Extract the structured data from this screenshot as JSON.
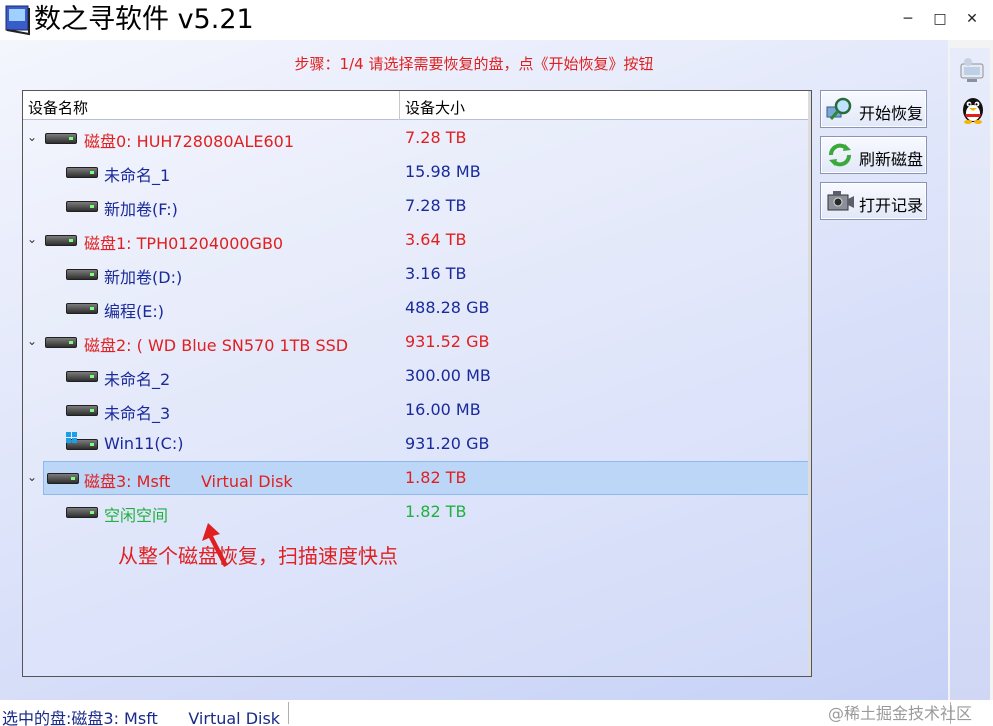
{
  "window": {
    "title": "数之寻软件 v5.21",
    "controls": {
      "minimize": "─",
      "maximize": "□",
      "close": "✕"
    }
  },
  "step_text": "步骤：1/4 请选择需要恢复的盘，点《开始恢复》按钮",
  "tree": {
    "headers": {
      "name": "设备名称",
      "size": "设备大小"
    },
    "rows": [
      {
        "name": "磁盘0: HUH728080ALE601",
        "size": "7.28 TB"
      },
      {
        "name": "未命名_1",
        "size": "15.98 MB"
      },
      {
        "name": "新加卷(F:)",
        "size": "7.28 TB"
      },
      {
        "name": "磁盘1: TPH01204000GB0",
        "size": "3.64 TB"
      },
      {
        "name": "新加卷(D:)",
        "size": "3.16 TB"
      },
      {
        "name": "编程(E:)",
        "size": "488.28 GB"
      },
      {
        "name": "磁盘2: ( WD Blue SN570 1TB SSD",
        "size": "931.52 GB"
      },
      {
        "name": "未命名_2",
        "size": "300.00 MB"
      },
      {
        "name": "未命名_3",
        "size": "16.00 MB"
      },
      {
        "name": "Win11(C:)",
        "size": "931.20 GB"
      },
      {
        "name": "磁盘3: Msft      Virtual Disk",
        "size": "1.82 TB"
      },
      {
        "name": "空闲空间",
        "size": "1.82 TB"
      }
    ]
  },
  "annotation": "从整个磁盘恢复，扫描速度快点",
  "buttons": {
    "start": "开始恢复",
    "refresh": "刷新磁盘",
    "open_log": "打开记录"
  },
  "status": {
    "selected": "选中的盘:磁盘3: Msft      Virtual Disk"
  },
  "watermark": "@稀土掘金技术社区",
  "colors": {
    "disk_red": "#e02020",
    "partition_blue": "#1a2a9a",
    "free_green": "#20b040",
    "selection": "#bcd6f8"
  }
}
